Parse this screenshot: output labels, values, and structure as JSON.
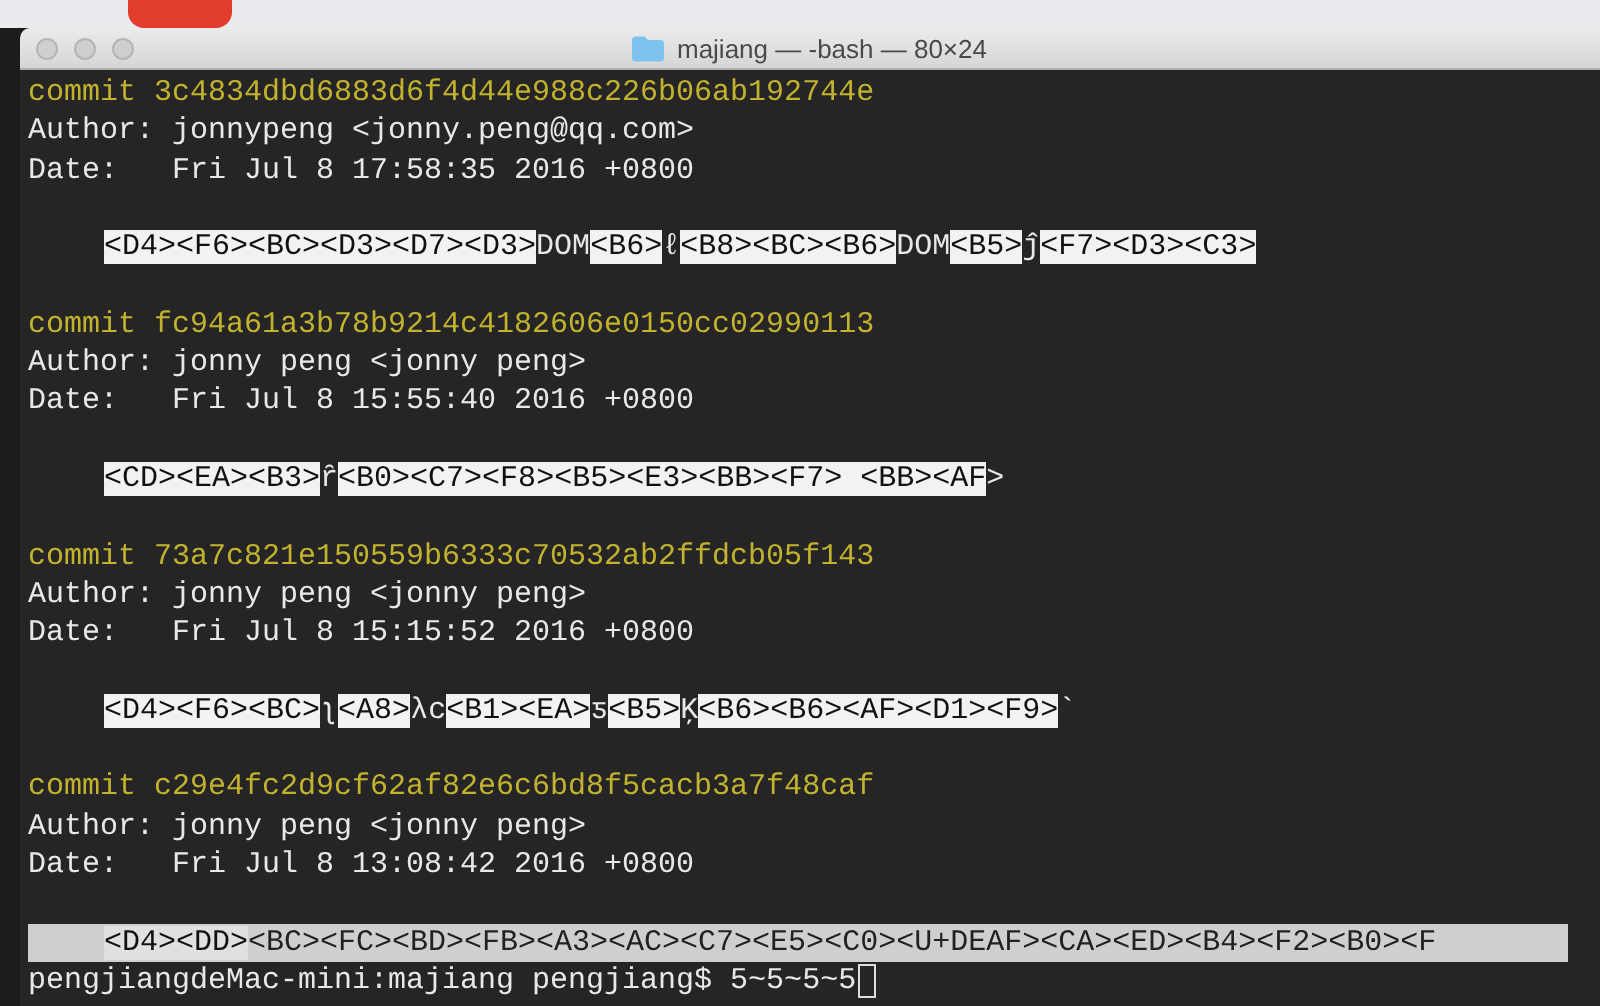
{
  "window": {
    "title": "majiang — -bash — 80×24"
  },
  "commits": [
    {
      "commit": "commit 3c4834dbd6883d6f4d44e988c226b06ab192744e",
      "author": "Author: jonnypeng <jonny.peng@qq.com>",
      "date": "Date:   Fri Jul 8 17:58:35 2016 +0800",
      "message": [
        {
          "text": "<D4><F6><BC><D3><D7><D3>",
          "highlighted": true
        },
        {
          "text": "DOM",
          "highlighted": false
        },
        {
          "text": "<B6>",
          "highlighted": true
        },
        {
          "text": "ℓ",
          "highlighted": false
        },
        {
          "text": "<B8><BC><B6>",
          "highlighted": true
        },
        {
          "text": "DOM",
          "highlighted": false
        },
        {
          "text": "<B5>",
          "highlighted": true
        },
        {
          "text": "ĵ",
          "highlighted": false
        },
        {
          "text": "<F7><D3><C3>",
          "highlighted": true
        }
      ]
    },
    {
      "commit": "commit fc94a61a3b78b9214c4182606e0150cc02990113",
      "author": "Author: jonny peng <jonny peng>",
      "date": "Date:   Fri Jul 8 15:55:40 2016 +0800",
      "message": [
        {
          "text": "<CD><EA><B3>",
          "highlighted": true
        },
        {
          "text": "ȓ",
          "highlighted": false
        },
        {
          "text": "<B0><C7><F8><B5><E3><BB><F7> <BB><AF",
          "highlighted": true
        },
        {
          "text": ">",
          "highlighted": false
        }
      ]
    },
    {
      "commit": "commit 73a7c821e150559b6333c70532ab2ffdcb05f143",
      "author": "Author: jonny peng <jonny peng>",
      "date": "Date:   Fri Jul 8 15:15:52 2016 +0800",
      "message": [
        {
          "text": "<D4><F6><BC>",
          "highlighted": true
        },
        {
          "text": "ʅ",
          "highlighted": false
        },
        {
          "text": "<A8>",
          "highlighted": true
        },
        {
          "text": "λc",
          "highlighted": false
        },
        {
          "text": "<B1><EA>",
          "highlighted": true
        },
        {
          "text": "ƽ",
          "highlighted": false
        },
        {
          "text": "<B5>",
          "highlighted": true
        },
        {
          "text": "Ķ",
          "highlighted": false
        },
        {
          "text": "<B6><B6><AF><D1><F9>",
          "highlighted": true
        },
        {
          "text": "`",
          "highlighted": false
        }
      ]
    },
    {
      "commit": "commit c29e4fc2d9cf62af82e6c6bd8f5cacb3a7f48caf",
      "author": "Author: jonny peng <jonny peng>",
      "date": "Date:   Fri Jul 8 13:08:42 2016 +0800",
      "message": [
        {
          "text": "<D4><DD>",
          "highlighted": true
        },
        {
          "text": "<BC><FC><BD><FB><A3><AC><C7><E5><C0><U+DEAF><CA><ED><B4><F2><B0><F",
          "highlighted": false
        }
      ]
    }
  ],
  "prompt": {
    "text": "pengjiangdeMac-mini:majiang pengjiang$ 5~5~5~5"
  }
}
